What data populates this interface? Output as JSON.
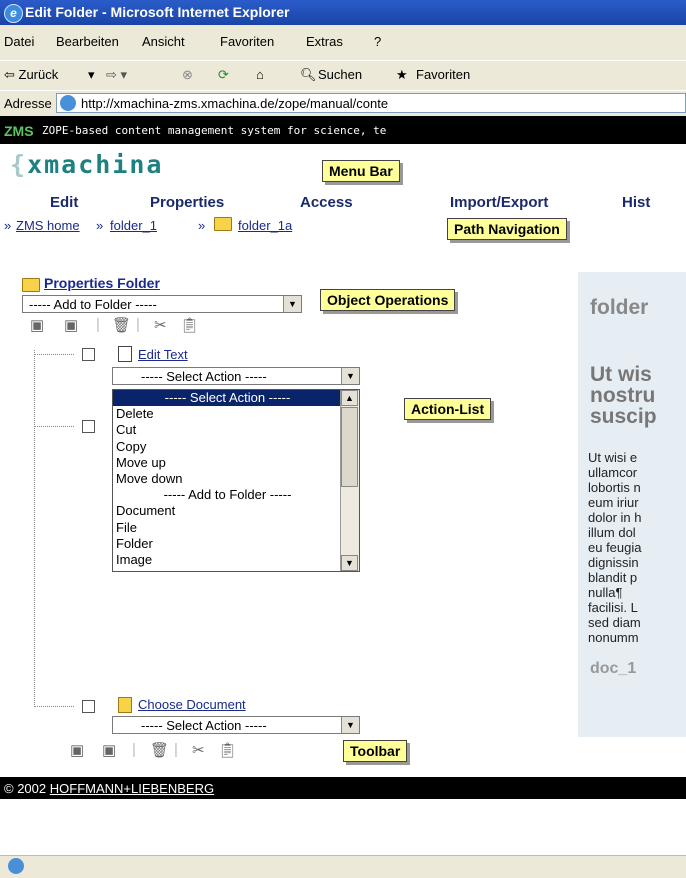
{
  "window": {
    "title": "Edit Folder - Microsoft Internet Explorer"
  },
  "menu": [
    "Datei",
    "Bearbeiten",
    "Ansicht",
    "Favoriten",
    "Extras",
    "?"
  ],
  "browser_toolbar": {
    "back": "⇦ Zurück",
    "search": "Suchen",
    "favorites": "Favoriten"
  },
  "address": {
    "label": "Adresse",
    "url": "http://xmachina-zms.xmachina.de/zope/manual/conte"
  },
  "zms": {
    "logo": "ZMS",
    "tagline": "ZOPE-based content management system for science, te"
  },
  "brand": {
    "open": "{",
    "name": "xmachina"
  },
  "callouts": {
    "menu_bar": "Menu Bar",
    "path_navigation": "Path Navigation",
    "object_operations": "Object Operations",
    "action_list": "Action-List",
    "toolbar": "Toolbar"
  },
  "main_menu": [
    "Edit",
    "Properties",
    "Access",
    "Import/Export",
    "Hist"
  ],
  "path": {
    "prefix": "»",
    "home": "ZMS home",
    "sep": "»",
    "folder1": "folder_1",
    "folder1a": "folder_1a"
  },
  "properties_link": "Properties Folder",
  "add_to_folder": "----- Add to Folder -----",
  "tree": {
    "edit_text": "Edit Text",
    "select_action": "----- Select Action -----",
    "choose_document": "Choose Document"
  },
  "action_list": [
    "----- Select Action -----",
    "Delete",
    "Cut",
    "Copy",
    "Move up",
    "Move down",
    "----- Add to Folder -----",
    "Document",
    "File",
    "Folder",
    "Image"
  ],
  "right_panel": {
    "heading": "folder",
    "title_lines": "Ut wis\nnostru\nsuscip",
    "body": "Ut wisi e\nullamcor\nlobortis n\neum iriur\ndolor in h\nillum dol\neu feugia\ndignissin\nblandit p\nnulla¶\nfacilisi. L\nsed diam\nnonumm",
    "doc_label": "doc_1"
  },
  "footer": {
    "copyright": "© 2002",
    "company": "HOFFMANN+LIEBENBERG"
  }
}
